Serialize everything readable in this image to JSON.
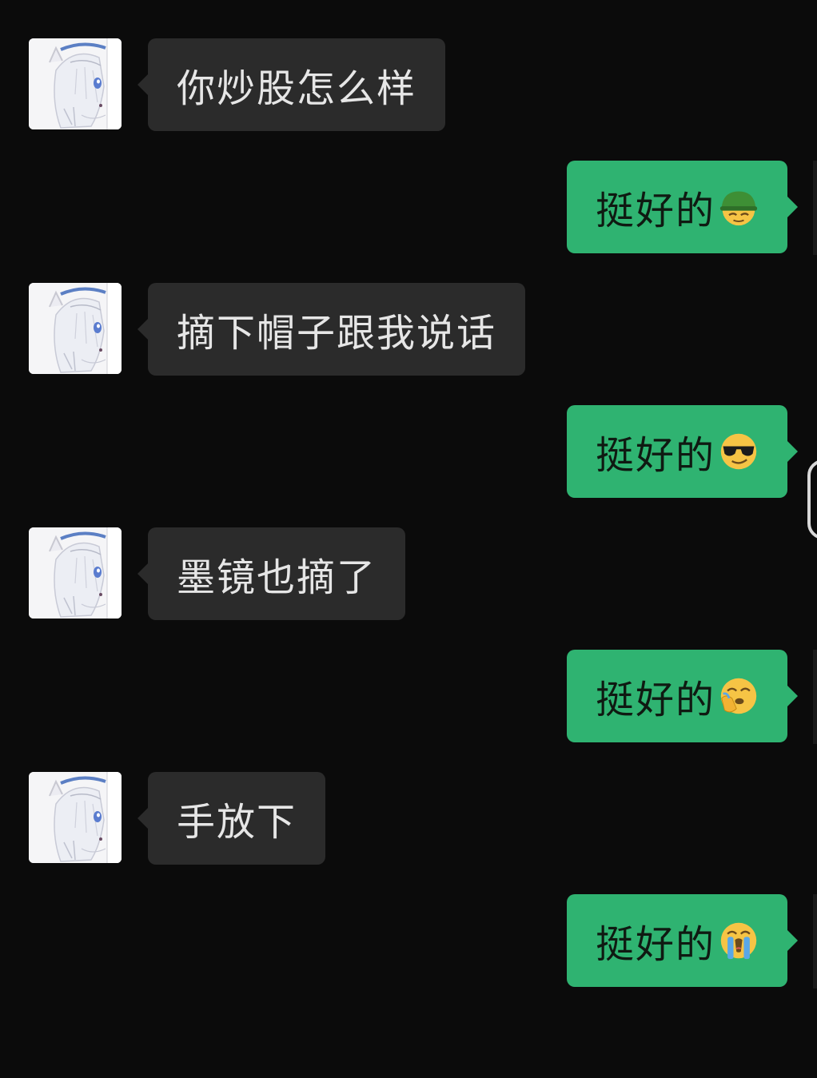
{
  "messages": [
    {
      "side": "in",
      "text": "你炒股怎么样"
    },
    {
      "side": "out",
      "text": "挺好的",
      "emoji": "helmet-emoji"
    },
    {
      "side": "in",
      "text": "摘下帽子跟我说话"
    },
    {
      "side": "out",
      "text": "挺好的",
      "emoji": "sunglasses-emoji"
    },
    {
      "side": "in",
      "text": "墨镜也摘了"
    },
    {
      "side": "out",
      "text": "挺好的",
      "emoji": "face-palm-emoji"
    },
    {
      "side": "in",
      "text": "手放下"
    },
    {
      "side": "out",
      "text": "挺好的",
      "emoji": "crying-emoji"
    }
  ],
  "colors": {
    "background": "#0b0b0b",
    "incoming_bubble": "#2b2b2b",
    "outgoing_bubble": "#2fb371",
    "incoming_text": "#e6e6e6",
    "outgoing_text": "#0f1a12"
  }
}
